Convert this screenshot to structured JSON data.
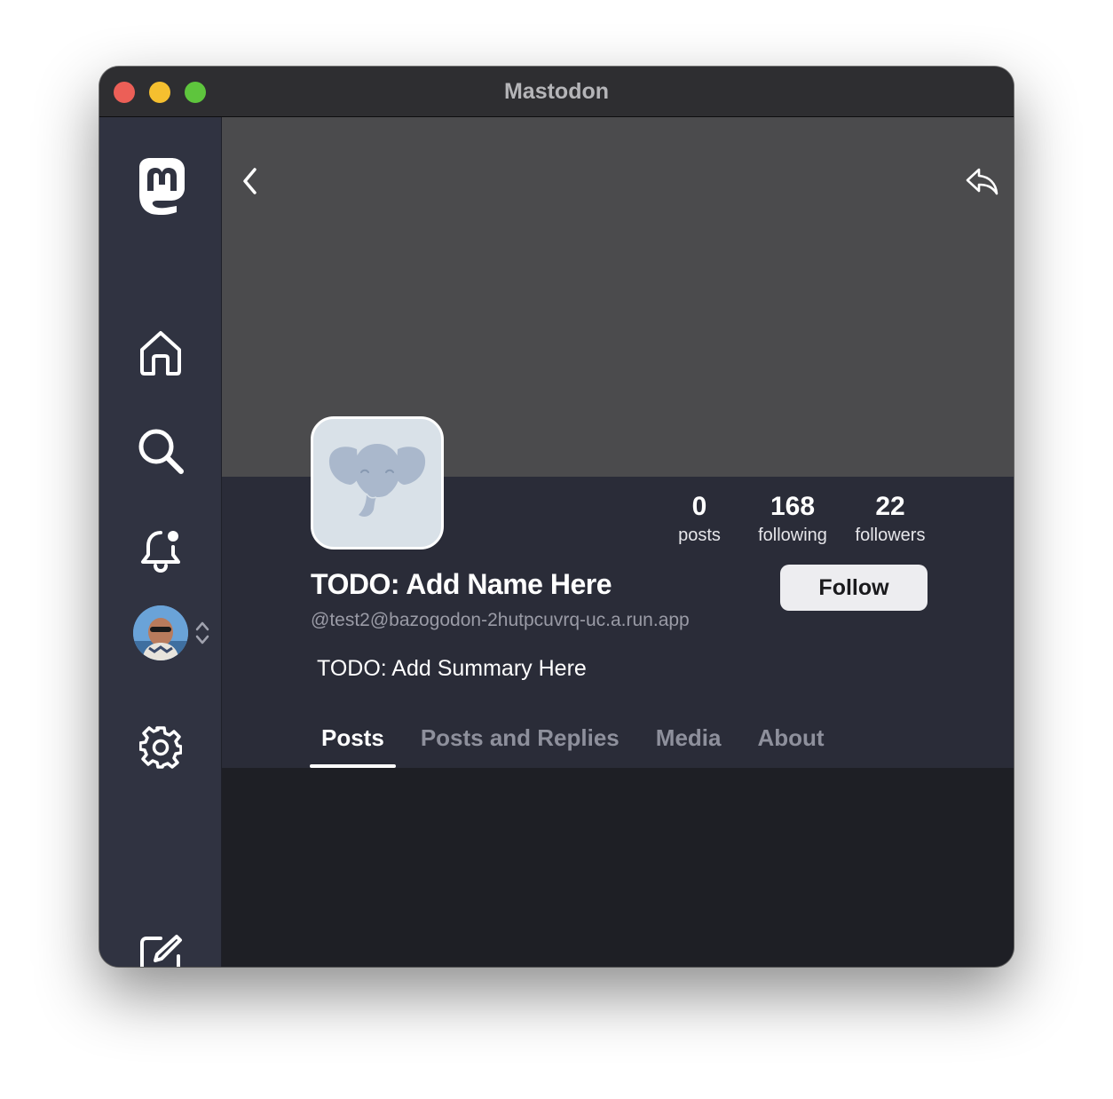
{
  "window": {
    "title": "Mastodon"
  },
  "sidebar": {
    "items": [
      {
        "name": "logo",
        "icon": "mastodon-logo-icon"
      },
      {
        "name": "home",
        "icon": "home-icon"
      },
      {
        "name": "search",
        "icon": "search-icon"
      },
      {
        "name": "notifications",
        "icon": "bell-icon"
      },
      {
        "name": "account",
        "icon": "avatar"
      },
      {
        "name": "settings",
        "icon": "gear-icon"
      },
      {
        "name": "compose",
        "icon": "compose-icon"
      }
    ]
  },
  "toolbar": {
    "back_icon": "chevron-left-icon",
    "reply_icon": "reply-icon",
    "more_icon": "more-icon"
  },
  "profile": {
    "display_name": "TODO: Add Name Here",
    "handle": "@test2@bazogodon-2hutpcuvrq-uc.a.run.app",
    "summary": "TODO: Add Summary Here",
    "follow_label": "Follow",
    "stats": {
      "posts": {
        "value": "0",
        "label": "posts"
      },
      "following": {
        "value": "168",
        "label": "following"
      },
      "followers": {
        "value": "22",
        "label": "followers"
      }
    }
  },
  "tabs": [
    {
      "label": "Posts",
      "active": true
    },
    {
      "label": "Posts and Replies",
      "active": false
    },
    {
      "label": "Media",
      "active": false
    },
    {
      "label": "About",
      "active": false
    }
  ],
  "colors": {
    "banner": "#4b4b4d",
    "header_bg": "#2a2c38",
    "sidebar_bg": "#303341",
    "feed_bg": "#1e1f25",
    "avatar_bg": "#d9e1e8",
    "elephant": "#aab8cc"
  }
}
